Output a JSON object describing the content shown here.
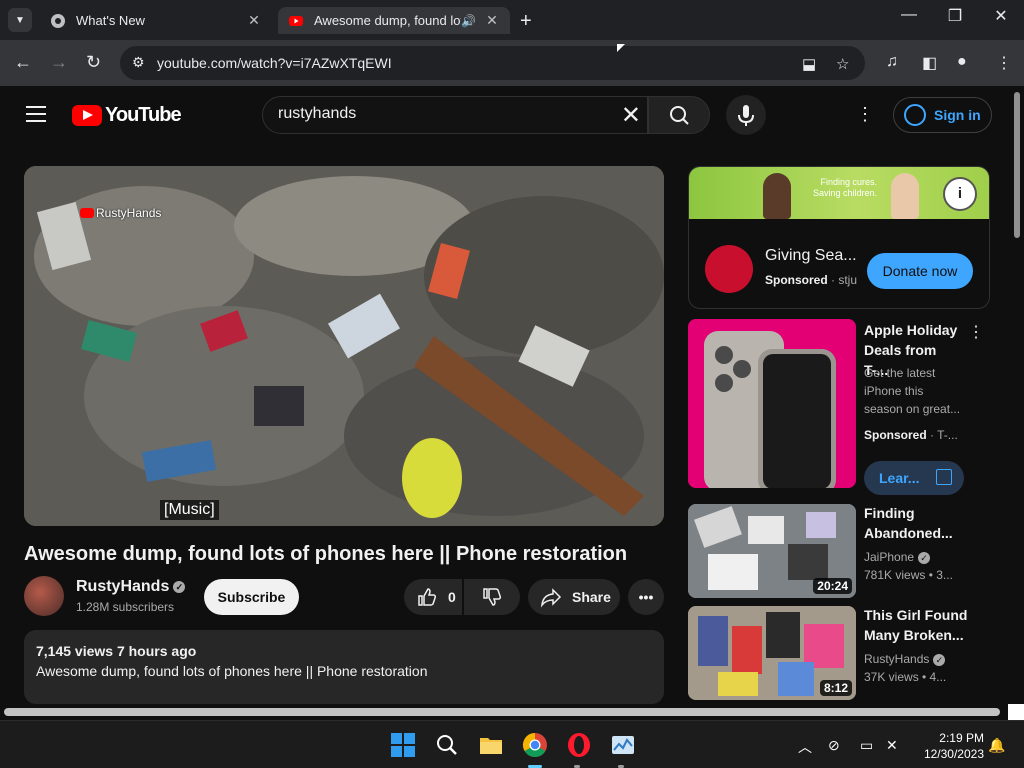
{
  "browser": {
    "tabs": [
      {
        "title": "What's New",
        "active": false
      },
      {
        "title": "Awesome dump, found lots of phones here || Phone restoration",
        "active": true
      }
    ],
    "url": "youtube.com/watch?v=i7AZwXTqEWI"
  },
  "header": {
    "logo_text": "YouTube",
    "search_value": "rustyhands",
    "signin_label": "Sign in"
  },
  "video": {
    "watermark": "RustyHands",
    "caption": "[Music]",
    "title": "Awesome dump, found lots of phones here || Phone restoration",
    "channel_name": "RustyHands",
    "subscribers": "1.28M subscribers",
    "subscribe_label": "Subscribe",
    "likes": "0",
    "share_label": "Share",
    "stats": "7,145 views  7 hours ago",
    "description": "Awesome dump, found lots of phones here || Phone restoration"
  },
  "ad": {
    "banner_text": "Finding cures. Saving children.",
    "name": "Giving Sea...",
    "sponsored": "Sponsored",
    "advertiser": "stju",
    "cta": "Donate now"
  },
  "promo": {
    "title": "Apple Holiday Deals from T-...",
    "description": "Get the latest iPhone this season on great...",
    "sponsored": "Sponsored",
    "advertiser": "T-...",
    "cta": "Lear..."
  },
  "recommendations": [
    {
      "title": "Finding Abandoned...",
      "channel": "JaiPhone",
      "meta": "781K views  • 3...",
      "duration": "20:24"
    },
    {
      "title": "This Girl Found Many Broken...",
      "channel": "RustyHands",
      "meta": "37K views  • 4...",
      "duration": "8:12"
    }
  ],
  "taskbar": {
    "time": "2:19 PM",
    "date": "12/30/2023"
  },
  "colors": {
    "youtube_red": "#ff0000",
    "link_blue": "#3ea6ff",
    "tmobile_magenta": "#e20074"
  }
}
